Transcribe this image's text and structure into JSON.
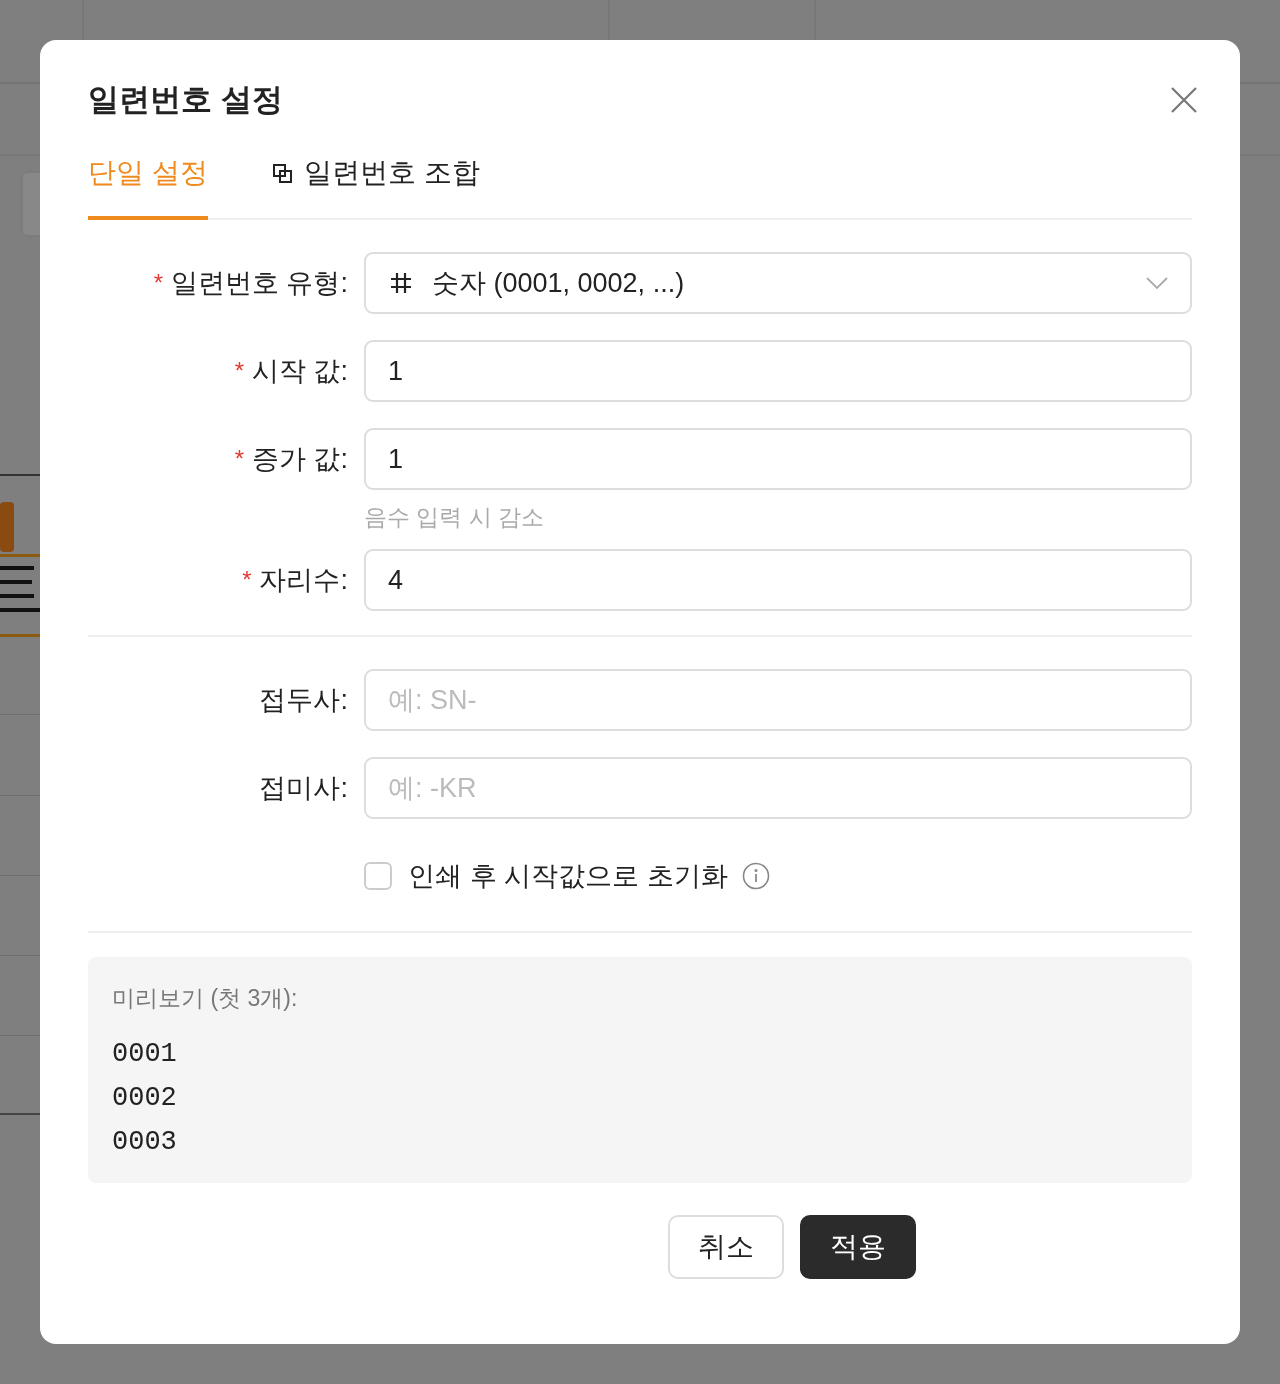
{
  "dialog": {
    "title": "일련번호 설정",
    "tabs": [
      {
        "label": "단일 설정",
        "selected": true,
        "kind": "text"
      },
      {
        "label": "일련번호 조합",
        "selected": false,
        "kind": "icon"
      }
    ],
    "sections": [
      {
        "fields": [
          {
            "kind": "select",
            "mark": "*",
            "label": "일련번호 유형:",
            "value": "숫자 (0001, 0002, ...)"
          },
          {
            "kind": "input",
            "mark": "*",
            "label": "시작 값:",
            "value": "1"
          },
          {
            "kind": "input",
            "mark": "*",
            "label": "증가 값:",
            "value": "1",
            "hint": "음수 입력 시 감소"
          },
          {
            "kind": "input",
            "mark": "*",
            "label": "자리수:",
            "value": "4"
          }
        ]
      },
      {
        "fields": [
          {
            "kind": "input",
            "label": "접두사:",
            "placeholder": "예: SN-"
          },
          {
            "kind": "input",
            "label": "접미사:",
            "placeholder": "예: -KR"
          }
        ],
        "checkbox": {
          "label": "인쇄 후 시작값으로 초기화",
          "checked": false
        }
      }
    ],
    "preview": {
      "title": "미리보기 (첫 3개):",
      "lines": [
        "0001",
        "0002",
        "0003"
      ]
    },
    "buttons": [
      {
        "label": "취소",
        "kind": "secondary"
      },
      {
        "label": "적용",
        "kind": "primary"
      }
    ]
  }
}
